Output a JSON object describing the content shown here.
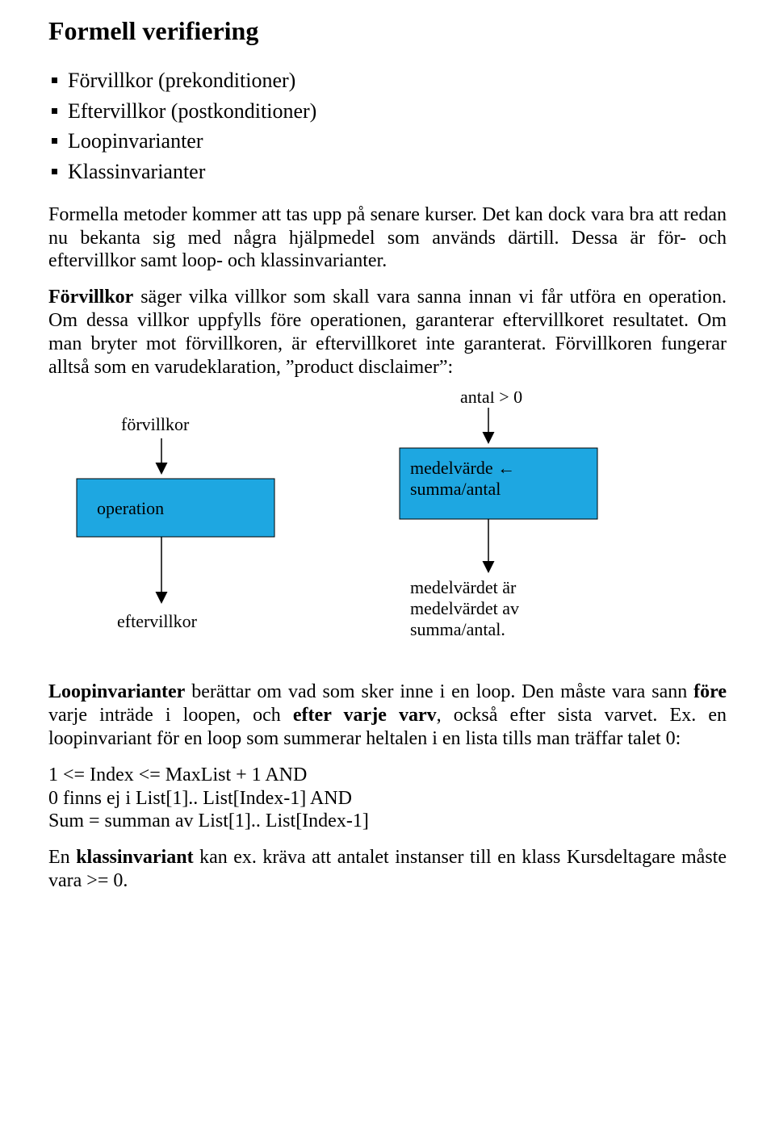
{
  "title": "Formell verifiering",
  "bullets": [
    "Förvillkor (prekonditioner)",
    "Eftervillkor (postkonditioner)",
    "Loopinvarianter",
    "Klassinvarianter"
  ],
  "para1": "Formella metoder kommer att tas upp på senare kurser. Det kan dock vara bra att redan nu bekanta sig med några hjälpmedel som används därtill. Dessa är för- och eftervillkor samt loop- och klassinvarianter.",
  "para2_prefix": "Förvillkor",
  "para2_rest": " säger vilka villkor som skall vara sanna innan vi får utföra en operation. Om dessa villkor uppfylls före operationen, garanterar eftervillkoret resultatet. Om man bryter mot förvillkoren, är eftervillkoret inte garanterat. Förvillkoren fungerar alltså som en varudeklaration, ”product disclaimer”:",
  "diagram": {
    "left": {
      "pre": "förvillkor",
      "op": "operation",
      "post": "eftervillkor"
    },
    "right": {
      "pre": "antal > 0",
      "op_line1": "medelvärde ←",
      "op_line2": "summa/antal",
      "post_line1": "medelvärdet är",
      "post_line2": "medelvärdet av",
      "post_line3": "summa/antal."
    }
  },
  "para3_prefix": "Loopinvarianter",
  "para3_mid1": " berättar om vad som sker inne i en loop. Den måste vara sann ",
  "para3_bold1": "före",
  "para3_mid2": " varje inträde i loopen, och ",
  "para3_bold2": "efter varje varv",
  "para3_mid3": ", också efter sista varvet. Ex. en loopinvariant för en loop som summerar heltalen i en lista tills man träffar talet 0:",
  "code1": "1 <= Index <= MaxList + 1 AND",
  "code2": "0 finns ej i List[1].. List[Index-1] AND",
  "code3": "Sum = summan av List[1].. List[Index-1]",
  "para4_pre": "En ",
  "para4_bold": "klassinvariant",
  "para4_post": " kan ex. kräva att antalet instanser till en klass Kursdeltagare måste vara >= 0."
}
